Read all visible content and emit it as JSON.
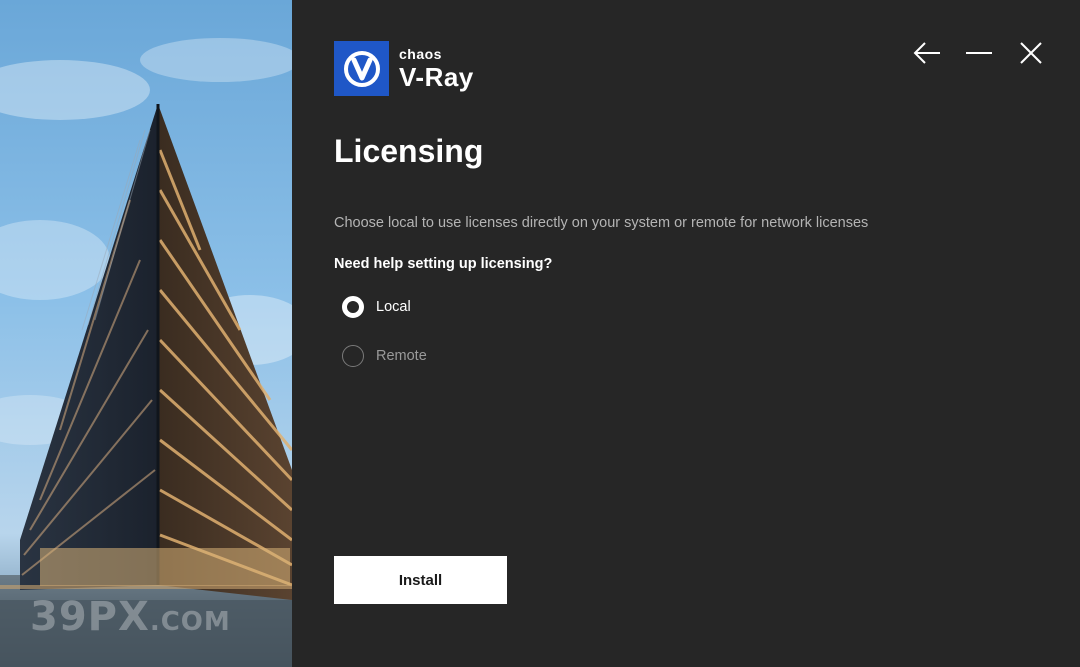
{
  "brand": {
    "company": "chaos",
    "product": "V-Ray",
    "logo_icon": "v-ray-logo-icon",
    "logo_color": "#1f57c7"
  },
  "window_controls": {
    "back_icon": "arrow-left-icon",
    "minimize_icon": "minimize-icon",
    "close_icon": "close-icon"
  },
  "page": {
    "title": "Licensing",
    "description": "Choose local to use licenses directly on your system or remote for network licenses",
    "help_link": "Need help setting up licensing?"
  },
  "license_options": [
    {
      "label": "Local",
      "selected": true
    },
    {
      "label": "Remote",
      "selected": false
    }
  ],
  "actions": {
    "install_label": "Install"
  },
  "hero": {
    "watermark_main": "39PX",
    "watermark_suffix": ".COM"
  },
  "colors": {
    "background": "#262626",
    "text_primary": "#ffffff",
    "text_secondary": "#b4b4b4",
    "button_bg": "#ffffff"
  }
}
